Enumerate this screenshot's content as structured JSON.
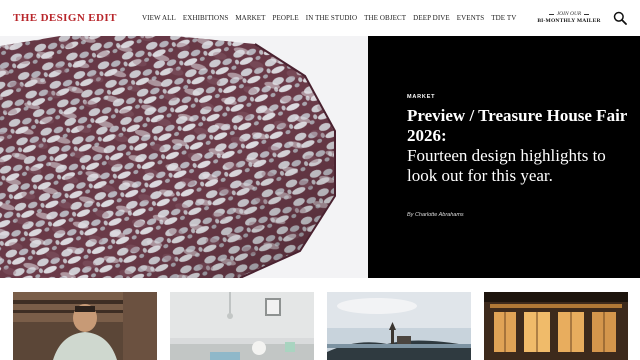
{
  "header": {
    "logo": "THE DESIGN EDIT",
    "nav": [
      "VIEW ALL",
      "EXHIBITIONS",
      "MARKET",
      "PEOPLE",
      "IN THE STUDIO",
      "THE OBJECT",
      "DEEP DIVE",
      "EVENTS",
      "TDE TV"
    ],
    "mailer_top": "JOIN OUR",
    "mailer_bottom": "BI-MONTHLY MAILER",
    "search_icon": "search-icon"
  },
  "hero": {
    "tag": "MARKET",
    "title_bold": "Preview / Treasure House Fair 2026:",
    "title_regular": "Fourteen design highlights to look out for this year.",
    "byline": "By Charlotte Abrahams"
  },
  "colors": {
    "brand": "#b8252a",
    "hero_panel": "#000000"
  }
}
